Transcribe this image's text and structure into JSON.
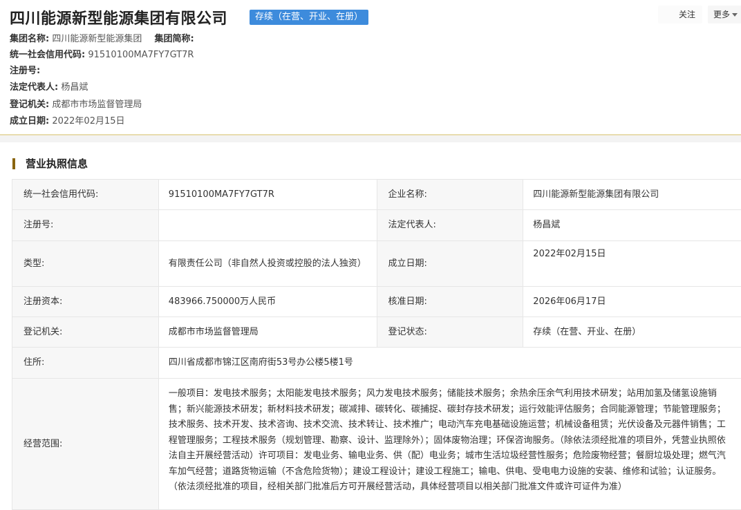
{
  "header": {
    "company_name": "四川能源新型能源集团有限公司",
    "status": "存续（在营、开业、在册）",
    "follow_label": "关注",
    "more_label": "更多",
    "group_name_label": "集团名称:",
    "group_name": "四川能源新型能源集团",
    "group_short_label": "集团简称:",
    "group_short": "",
    "credit_code_label": "统一社会信用代码:",
    "credit_code": "91510100MA7FY7GT7R",
    "reg_no_label": "注册号:",
    "reg_no": "",
    "legal_rep_label": "法定代表人:",
    "legal_rep": "杨昌斌",
    "authority_label": "登记机关:",
    "authority": "成都市市场监督管理局",
    "founded_label": "成立日期:",
    "founded": "2022年02月15日"
  },
  "section": {
    "title": "营业执照信息"
  },
  "license": {
    "credit_code_label": "统一社会信用代码:",
    "credit_code": "91510100MA7FY7GT7R",
    "company_label": "企业名称:",
    "company": "四川能源新型能源集团有限公司",
    "reg_no_label": "注册号:",
    "reg_no": "",
    "legal_rep_label": "法定代表人:",
    "legal_rep": "杨昌斌",
    "type_label": "类型:",
    "type": "有限责任公司（非自然人投资或控股的法人独资）",
    "founded_label": "成立日期:",
    "founded": "2022年02月15日",
    "capital_label": "注册资本:",
    "capital": "483966.750000万人民币",
    "approved_label": "核准日期:",
    "approved": "2026年06月17日",
    "authority_label": "登记机关:",
    "authority": "成都市市场监督管理局",
    "reg_status_label": "登记状态:",
    "reg_status": "存续（在营、开业、在册）",
    "address_label": "住所:",
    "address": "四川省成都市锦江区南府街53号办公楼5楼1号",
    "scope_label": "经营范围:",
    "scope": "一般项目：发电技术服务；太阳能发电技术服务；风力发电技术服务；储能技术服务；余热余压余气利用技术研发；站用加氢及储氢设施销售；新兴能源技术研发；新材料技术研发；碳减排、碳转化、碳捕捉、碳封存技术研发；运行效能评估服务；合同能源管理；节能管理服务；技术服务、技术开发、技术咨询、技术交流、技术转让、技术推广；电动汽车充电基础设施运营；机械设备租赁；光伏设备及元器件销售；工程管理服务；工程技术服务（规划管理、勘察、设计、监理除外）；固体废物治理；环保咨询服务。（除依法须经批准的项目外，凭营业执照依法自主开展经营活动）许可项目：发电业务、输电业务、供（配）电业务；城市生活垃圾经营性服务；危险废物经营；餐厨垃圾处理；燃气汽车加气经营；道路货物运输（不含危险货物）；建设工程设计；建设工程施工；输电、供电、受电电力设施的安装、维修和试验；认证服务。（依法须经批准的项目，经相关部门批准后方可开展经营活动，具体经营项目以相关部门批准文件或许可证件为准）"
  },
  "colors": {
    "status_badge": "#3d8bdc",
    "section_bar": "#8a6510",
    "divider": "#e8dcae"
  }
}
